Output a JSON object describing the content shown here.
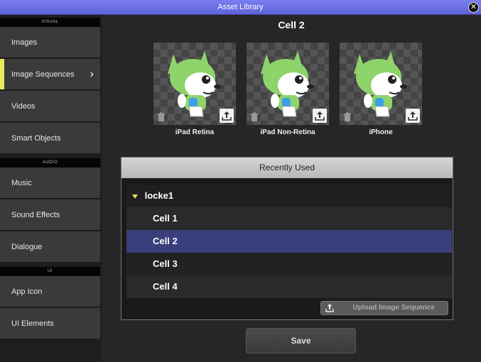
{
  "window": {
    "title": "Asset Library"
  },
  "sidebar": {
    "sections": [
      {
        "header": "VISUAL",
        "items": [
          "Images",
          "Image Sequences",
          "Videos",
          "Smart Objects"
        ]
      },
      {
        "header": "AUDIO",
        "items": [
          "Music",
          "Sound Effects",
          "Dialogue"
        ]
      },
      {
        "header": "UI",
        "items": [
          "App Icon",
          "UI Elements"
        ]
      }
    ],
    "active_item": "Image Sequences"
  },
  "main": {
    "title": "Cell 2",
    "thumbnails": [
      {
        "label": "iPad Retina"
      },
      {
        "label": "iPad Non-Retina"
      },
      {
        "label": "iPhone"
      }
    ],
    "recent": {
      "header": "Recently Used",
      "group": "locke1",
      "items": [
        "Cell 1",
        "Cell 2",
        "Cell 3",
        "Cell 4"
      ],
      "selected": "Cell 2",
      "upload_label": "Upload Image Sequence"
    },
    "save_label": "Save"
  },
  "colors": {
    "accent": "#e7e85a",
    "selection": "#3a3f7c",
    "titlebar": "#6a6ee6"
  }
}
